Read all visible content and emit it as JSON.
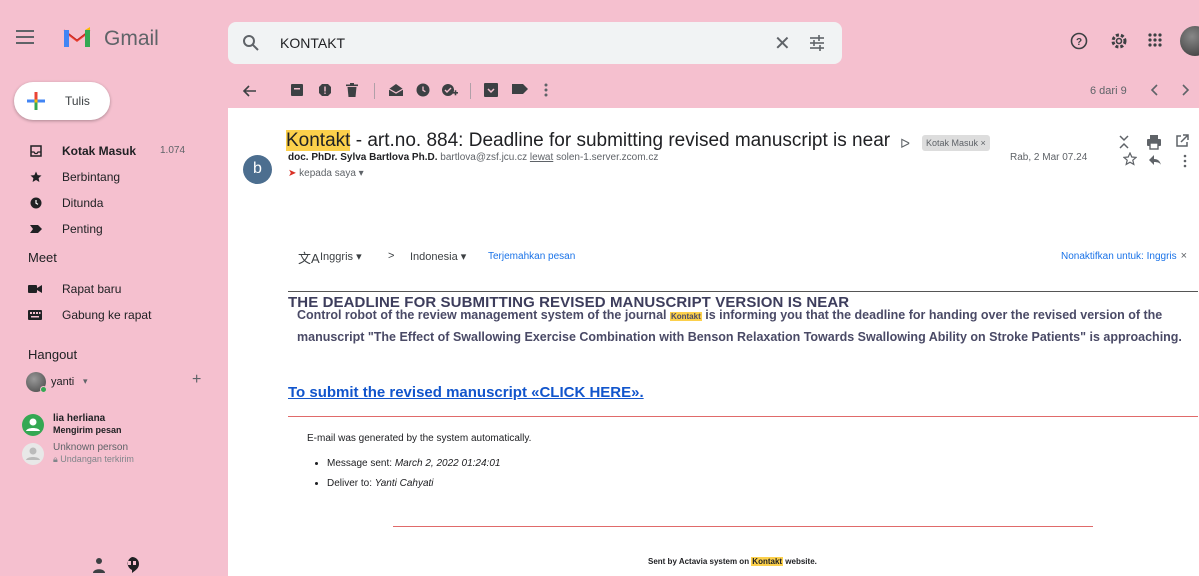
{
  "app": {
    "name": "Gmail"
  },
  "search": {
    "query": "KONTAKT"
  },
  "compose": {
    "label": "Tulis"
  },
  "sidebar": {
    "items": [
      {
        "label": "Kotak Masuk",
        "count": "1.074",
        "icon": "inbox-icon"
      },
      {
        "label": "Berbintang",
        "icon": "star-icon"
      },
      {
        "label": "Ditunda",
        "icon": "clock-icon"
      },
      {
        "label": "Penting",
        "icon": "important-icon"
      }
    ],
    "meet": {
      "title": "Meet",
      "items": [
        {
          "label": "Rapat baru",
          "icon": "video-icon"
        },
        {
          "label": "Gabung ke rapat",
          "icon": "keyboard-icon"
        }
      ]
    },
    "hangout": {
      "title": "Hangout",
      "user": "yanti",
      "contacts": [
        {
          "name": "lia herliana",
          "status": "Mengirim pesan"
        },
        {
          "name": "Unknown person",
          "status": "Undangan terkirim"
        }
      ]
    }
  },
  "toolbar": {
    "pager": "6 dari 9"
  },
  "email": {
    "subject_highlight": "Kontakt",
    "subject_rest": " - art.no. 884: Deadline for submitting revised manuscript is near",
    "label": "Kotak Masuk ×",
    "sender_name": "doc. PhDr. Sylva Bartlova Ph.D.",
    "sender_email": "bartlova@zsf.jcu.cz",
    "via_label": "lewat",
    "via_server": "solen-1.server.zcom.cz",
    "to": "kepada saya",
    "date": "Rab, 2 Mar 07.24",
    "avatar_letter": "b"
  },
  "translate": {
    "from": "Inggris",
    "to": "Indonesia",
    "action": "Terjemahkan pesan",
    "disable": "Nonaktifkan untuk: Inggris",
    "arrow": ">"
  },
  "content": {
    "heading": "THE DEADLINE FOR SUBMITTING REVISED MANUSCRIPT VERSION IS NEAR",
    "para_before": "Control robot of the review management system of the journal ",
    "para_highlight": "Kontakt",
    "para_after": " is informing you that the deadline for handing over the revised version of the manuscript \"The Effect of Swallowing Exercise Combination with Benson Relaxation Towards Swallowing Ability on Stroke Patients\" is approaching.",
    "link": "To submit the revised manuscript «CLICK HERE».",
    "auto": "E-mail was generated by the system automatically.",
    "sent_label": "Message sent: ",
    "sent_value": "March 2, 2022 01:24:01",
    "deliver_label": "Deliver to: ",
    "deliver_value": "Yanti Cahyati",
    "footer_before": "Sent by Actavia system on ",
    "footer_highlight": "Kontakt",
    "footer_after": " website."
  },
  "colors": {
    "background": "#f5c0cf",
    "highlight": "#fcd04b",
    "link": "#1155cc",
    "accent_red": "#e06a6a"
  }
}
